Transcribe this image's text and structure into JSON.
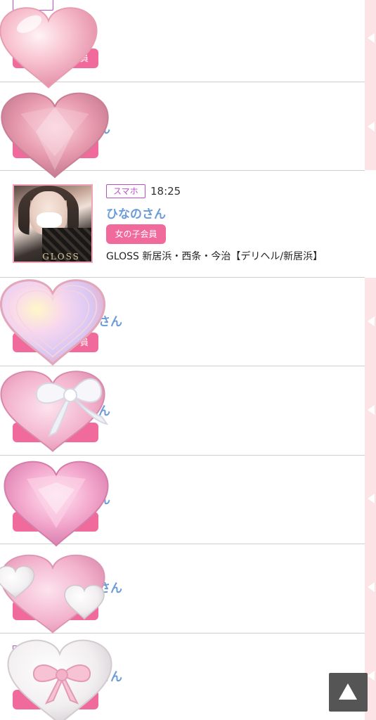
{
  "rows": [
    {
      "badge": "",
      "time": "",
      "name": "",
      "button": "",
      "shop": ""
    },
    {
      "badge": "",
      "time": "",
      "name": "ん",
      "button": "",
      "shop": ""
    },
    {
      "badge": "スマホ",
      "time": "18:25",
      "name": "ひなのさん",
      "button": "女の子会員",
      "shop": "GLOSS 新居浜・西条・今治【デリヘル/新居浜】",
      "thumb_logo": "GLOSS"
    },
    {
      "badge": "",
      "time": "",
      "name": "さん",
      "button": "員",
      "shop": ""
    },
    {
      "badge": "",
      "time": "",
      "name": "ん",
      "button": "",
      "shop": ""
    },
    {
      "badge": "",
      "time": "",
      "name": "ん",
      "button": "",
      "shop": ""
    },
    {
      "badge": "",
      "time": "",
      "name": "さん",
      "button": "",
      "shop": ""
    },
    {
      "badge": "",
      "time": "",
      "name": "さん",
      "button": "",
      "shop": ""
    }
  ],
  "row0_button": "員",
  "icons": {
    "back_to_top": "up-triangle-icon",
    "decorations": [
      "pink-glossy-heart",
      "pink-crystal-heart",
      "iridescent-heart",
      "ribbon-heart",
      "pink-diamond-heart",
      "heart-with-small-hearts",
      "white-ribbon-heart"
    ]
  },
  "colors": {
    "accent_pink": "#f06a9c",
    "badge_purple": "#b84fc7",
    "name_blue": "#6b9bd9",
    "rail_pink": "#fbe3e6"
  }
}
